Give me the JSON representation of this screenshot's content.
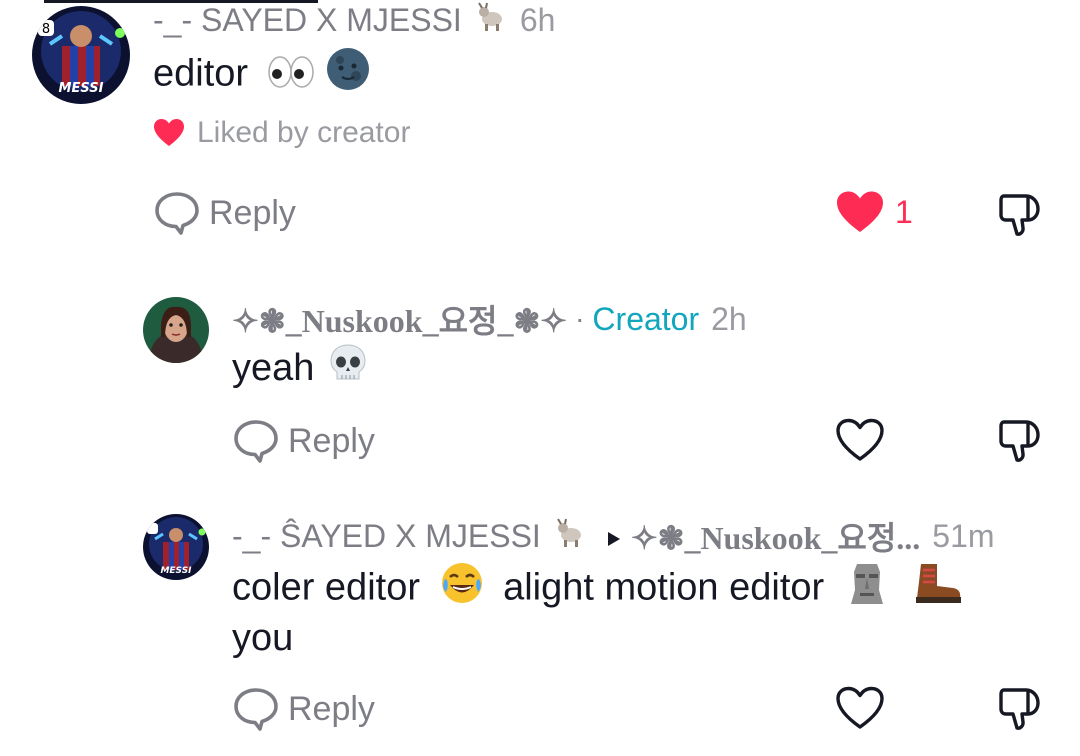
{
  "colors": {
    "accent_like": "#fe2c55",
    "creator_badge": "#11a6bd",
    "muted_text": "#7d7e85",
    "primary_text": "#161823"
  },
  "comment1": {
    "author": "-_- SAYED X MJESSI",
    "author_emoji": "goat",
    "time": "6h",
    "text": "editor",
    "text_emojis": "eyes, new-moon-face",
    "liked_by": "Liked by creator",
    "reply_label": "Reply",
    "like_count": "1",
    "liked": true
  },
  "comment2": {
    "author": "✧❃_Nuskook_요정_❃✧",
    "separator": "·",
    "badge": "Creator",
    "time": "2h",
    "text": "yeah",
    "text_emojis": "skull",
    "reply_label": "Reply"
  },
  "comment3": {
    "author": "-_- ŜAYED X MJESSI",
    "author_emoji": "goat",
    "reply_to": "✧❃_Nuskook_요정...",
    "time": "51m",
    "text_line1_a": "coler editor",
    "text_line1_b": "alight motion editor",
    "text_line2": "you",
    "text_emojis": "joy, moai, hiking-boot",
    "reply_label": "Reply"
  },
  "icons": [
    "heart-icon",
    "reply-icon",
    "dislike-icon",
    "skull-icon",
    "eyes-icon",
    "moon-face-icon",
    "goat-icon",
    "joy-icon",
    "moai-icon",
    "boot-icon",
    "play-arrow-icon"
  ]
}
